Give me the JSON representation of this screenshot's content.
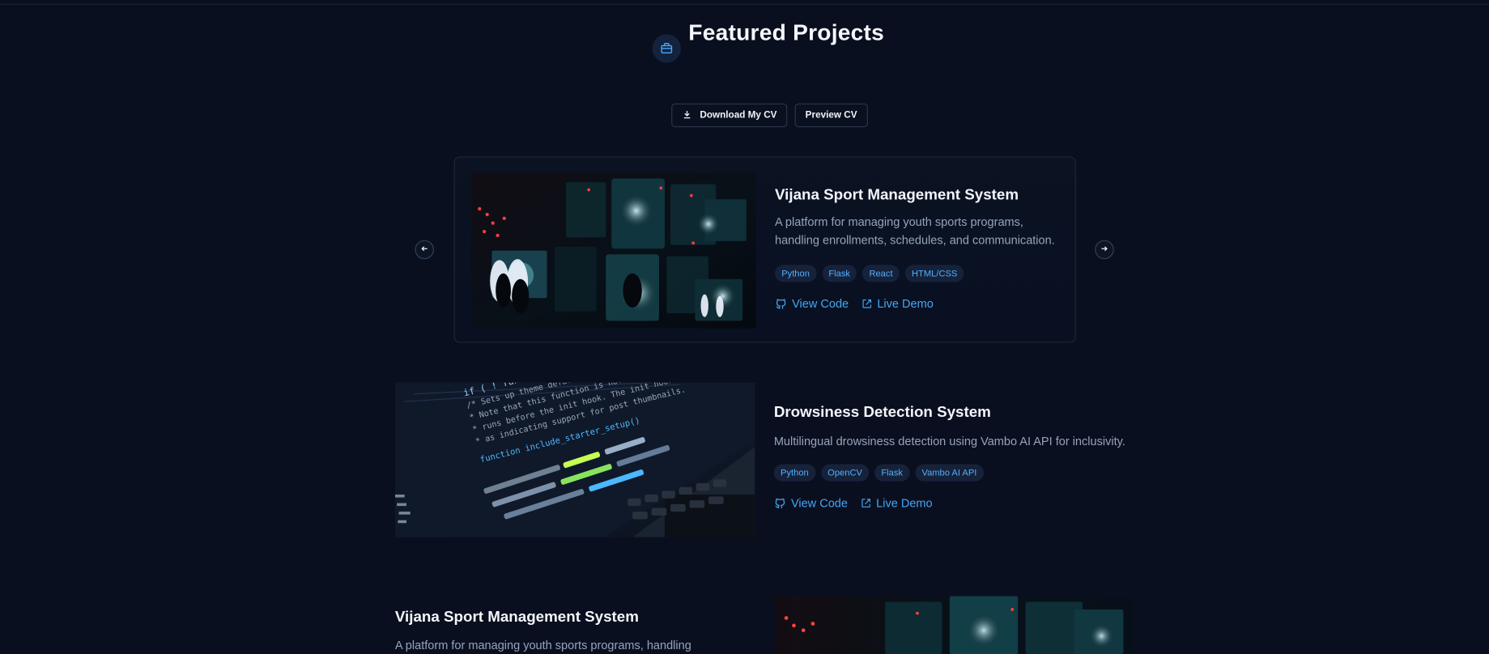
{
  "header": {
    "title": "Featured Projects"
  },
  "actions": {
    "download_cv": "Download My CV",
    "preview_cv": "Preview CV"
  },
  "featured": {
    "title": "Vijana Sport Management System",
    "description_line1": "A platform for managing youth sports programs,",
    "description_line2": "handling enrollments, schedules, and communication.",
    "tags": [
      "Python",
      "Flask",
      "React",
      "HTML/CSS"
    ],
    "links": {
      "code": "View Code",
      "demo": "Live Demo"
    }
  },
  "project2": {
    "title": "Drowsiness Detection System",
    "description": "Multilingual drowsiness detection using Vambo AI API for inclusivity.",
    "tags": [
      "Python",
      "OpenCV",
      "Flask",
      "Vambo AI API"
    ],
    "links": {
      "code": "View Code",
      "demo": "Live Demo"
    },
    "code_lines": [
      "if ( ! function_exists(",
      "/* Sets up theme defaults and regis",
      " * Note that this function is hooked into the",
      " * runs before the init hook. The init hook",
      " * as indicating support for post thumbnails.",
      "function include_starter_setup()"
    ]
  },
  "project3": {
    "title": "Vijana Sport Management System",
    "description_preview": "A platform for managing youth sports programs, handling"
  },
  "icons": {
    "title": "briefcase-icon",
    "download": "download-icon",
    "github": "github-icon",
    "external": "external-link-icon",
    "prev": "arrow-left-icon",
    "next": "arrow-right-icon"
  },
  "colors": {
    "background": "#0a0f1f",
    "accent": "#43a7f5",
    "tag_bg": "#16223a",
    "muted": "#95a4bb"
  }
}
